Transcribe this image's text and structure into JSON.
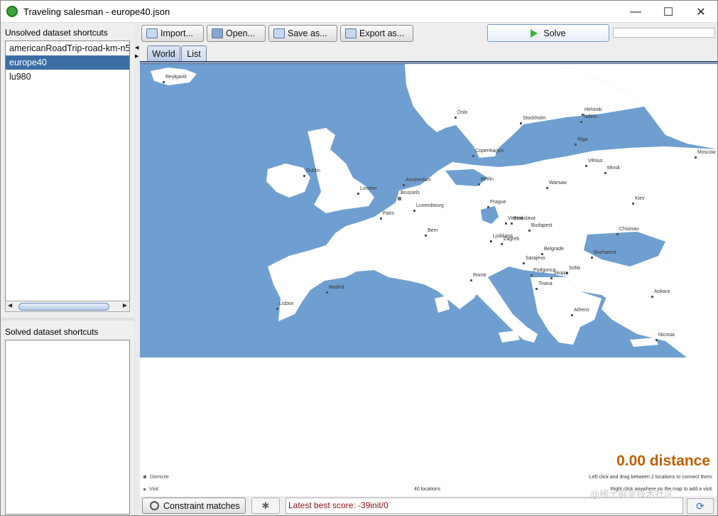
{
  "window": {
    "title": "Traveling salesman - europe40.json",
    "minimize": "—",
    "maximize": "☐",
    "close": "✕"
  },
  "left_panel": {
    "unsolved_label": "Unsolved dataset shortcuts",
    "unsolved_items": [
      "americanRoadTrip-road-km-n5",
      "europe40",
      "lu980"
    ],
    "selected_index": 1,
    "solved_label": "Solved dataset shortcuts",
    "solved_items": []
  },
  "toolbar": {
    "import_label": "Import...",
    "open_label": "Open...",
    "save_label": "Save as...",
    "export_label": "Export as...",
    "solve_label": "Solve"
  },
  "tabs": [
    {
      "label": "World",
      "active": true
    },
    {
      "label": "List",
      "active": false
    }
  ],
  "map": {
    "land_color": "#ffffff",
    "sea_color": "#6f9fd0",
    "cities": [
      {
        "name": "Reykjavik"
      },
      {
        "name": "Oslo"
      },
      {
        "name": "Stockholm"
      },
      {
        "name": "Helsinki"
      },
      {
        "name": "Tallinn"
      },
      {
        "name": "Riga"
      },
      {
        "name": "Moscow"
      },
      {
        "name": "Copenhagen"
      },
      {
        "name": "Vilnius"
      },
      {
        "name": "Minsk"
      },
      {
        "name": "Dublin"
      },
      {
        "name": "Amsterdam"
      },
      {
        "name": "Berlin"
      },
      {
        "name": "Warsaw"
      },
      {
        "name": "London"
      },
      {
        "name": "Brussels"
      },
      {
        "name": "Luxembourg"
      },
      {
        "name": "Kiev"
      },
      {
        "name": "Paris"
      },
      {
        "name": "Prague"
      },
      {
        "name": "Vienna"
      },
      {
        "name": "Bratislava"
      },
      {
        "name": "Budapest"
      },
      {
        "name": "Chisinau"
      },
      {
        "name": "Bern"
      },
      {
        "name": "Ljubljana"
      },
      {
        "name": "Zagreb"
      },
      {
        "name": "Belgrade"
      },
      {
        "name": "Bucharest"
      },
      {
        "name": "Sarajevo"
      },
      {
        "name": "Podgorica"
      },
      {
        "name": "Sofia"
      },
      {
        "name": "Skopje"
      },
      {
        "name": "Rome"
      },
      {
        "name": "Tirana"
      },
      {
        "name": "Madrid"
      },
      {
        "name": "Lisbon"
      },
      {
        "name": "Ankara"
      },
      {
        "name": "Athens"
      },
      {
        "name": "Nicosia"
      }
    ],
    "distance_text": "0.00 distance",
    "hint_line1": "Left click and drag between 2 locations to connect them.",
    "hint_line2": "Right click anywhere on the map to add a visit.",
    "location_count": "40 locations",
    "legend_domicile": "Domicile",
    "legend_visit": "Visit"
  },
  "bottom": {
    "constraint_label": "Constraint matches",
    "status_text": "Latest best score: -39init/0",
    "watermark": "@稀土掘金技术社区"
  }
}
